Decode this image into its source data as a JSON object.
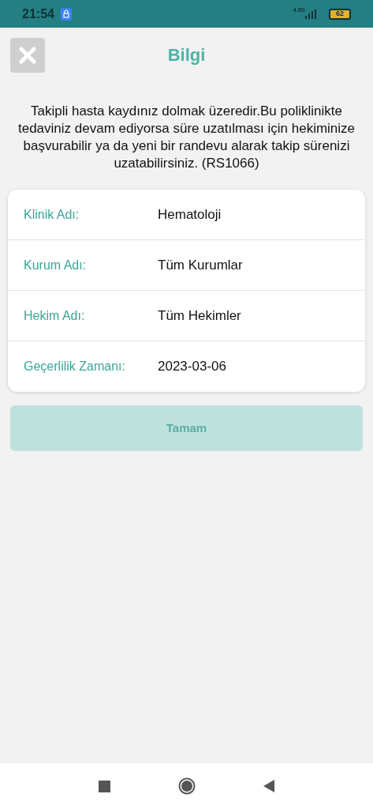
{
  "status_bar": {
    "time": "21:54",
    "network": "4.5G",
    "battery": "62"
  },
  "header": {
    "title": "Bilgi"
  },
  "message": "Takipli hasta kaydınız dolmak üzeredir.Bu poliklinikte tedaviniz devam ediyorsa süre uzatılması için hekiminize başvurabilir ya da yeni bir randevu alarak takip sürenizi uzatabilirsiniz. (RS1066)",
  "details": [
    {
      "label": "Klinik Adı:",
      "value": "Hematoloji"
    },
    {
      "label": "Kurum Adı:",
      "value": "Tüm Kurumlar"
    },
    {
      "label": "Hekim Adı:",
      "value": "Tüm Hekimler"
    },
    {
      "label": "Geçerlilik Zamanı:",
      "value": "2023-03-06"
    }
  ],
  "ok_button": {
    "label": "Tamam",
    "disabled": true
  }
}
